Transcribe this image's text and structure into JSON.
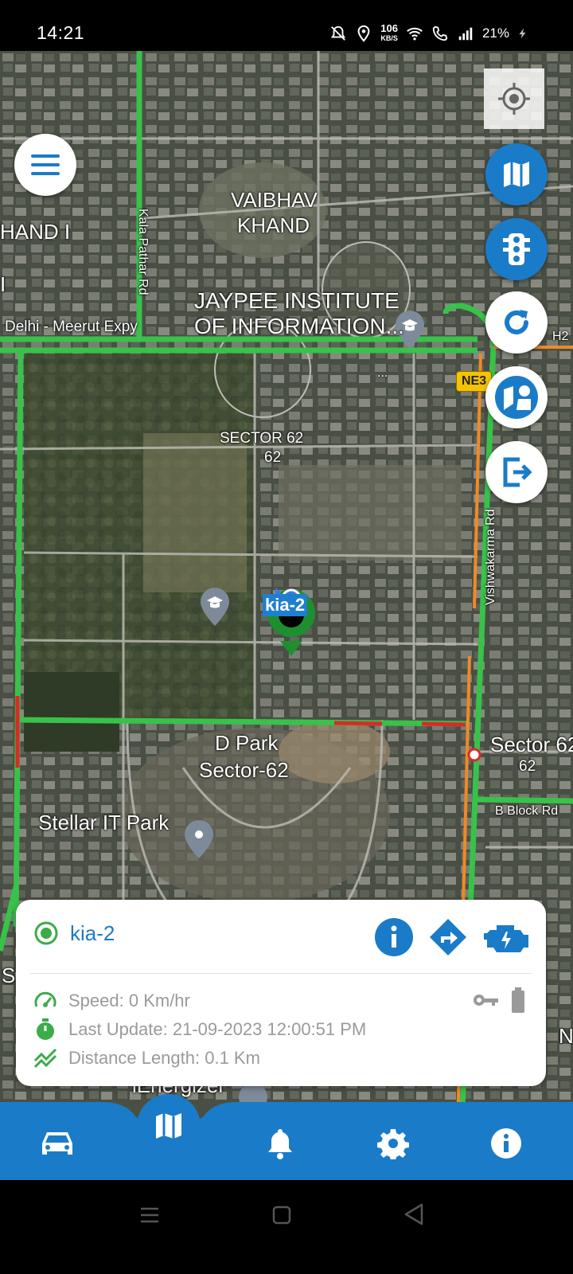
{
  "status_bar": {
    "time": "14:21",
    "net_speed": "106",
    "net_unit": "KB/S",
    "battery": "21%",
    "icons": [
      "mute-icon",
      "location-icon",
      "wifi-icon",
      "wifi-call-icon",
      "signal-icon",
      "battery-charging-icon"
    ]
  },
  "map": {
    "labels": {
      "vaibhav_khand_1": "VAIBHAV",
      "vaibhav_khand_2": "KHAND",
      "khand_left": "HAND I",
      "khand_left_2": "I",
      "kala_pathar": "Kala Pathar Rd",
      "delhi_meerut": "Delhi - Meerut Expy",
      "jaypee_1": "JAYPEE INSTITUTE",
      "jaypee_2": "OF INFORMATION...",
      "ne3": "NE3",
      "h2": "H2",
      "sector62_1": "SECTOR 62",
      "sector62_2": "62",
      "vishwakarma": "Vishwakarma Rd",
      "dpark_1": "D Park",
      "dpark_2": "Sector-62",
      "sector62e_1": "Sector 62",
      "sector62e_2": "62",
      "bblock": "B Block Rd",
      "stellar": "Stellar IT Park",
      "energizer": "iEnergizer",
      "edge_s": "S",
      "edge_n": "N",
      "dots": "..."
    },
    "vehicle_tag": "kia-2"
  },
  "controls": {
    "menu": "menu-icon",
    "locate": "crosshair-icon",
    "fabs": [
      "map-icon",
      "traffic-light-icon",
      "refresh-icon",
      "map-layers-icon",
      "exit-icon"
    ]
  },
  "card": {
    "vehicle_name": "kia-2",
    "speed": "Speed: 0 Km/hr",
    "last_update": "Last Update: 21-09-2023 12:00:51 PM",
    "distance": "Distance Length: 0.1 Km",
    "colors": {
      "accent": "#1a7bc9",
      "status_green": "#3cab4a",
      "muted": "#9a9a9a"
    }
  },
  "bottom_nav": {
    "items": [
      "car-icon",
      "map-icon",
      "bell-icon",
      "settings-icon",
      "info-icon"
    ]
  }
}
